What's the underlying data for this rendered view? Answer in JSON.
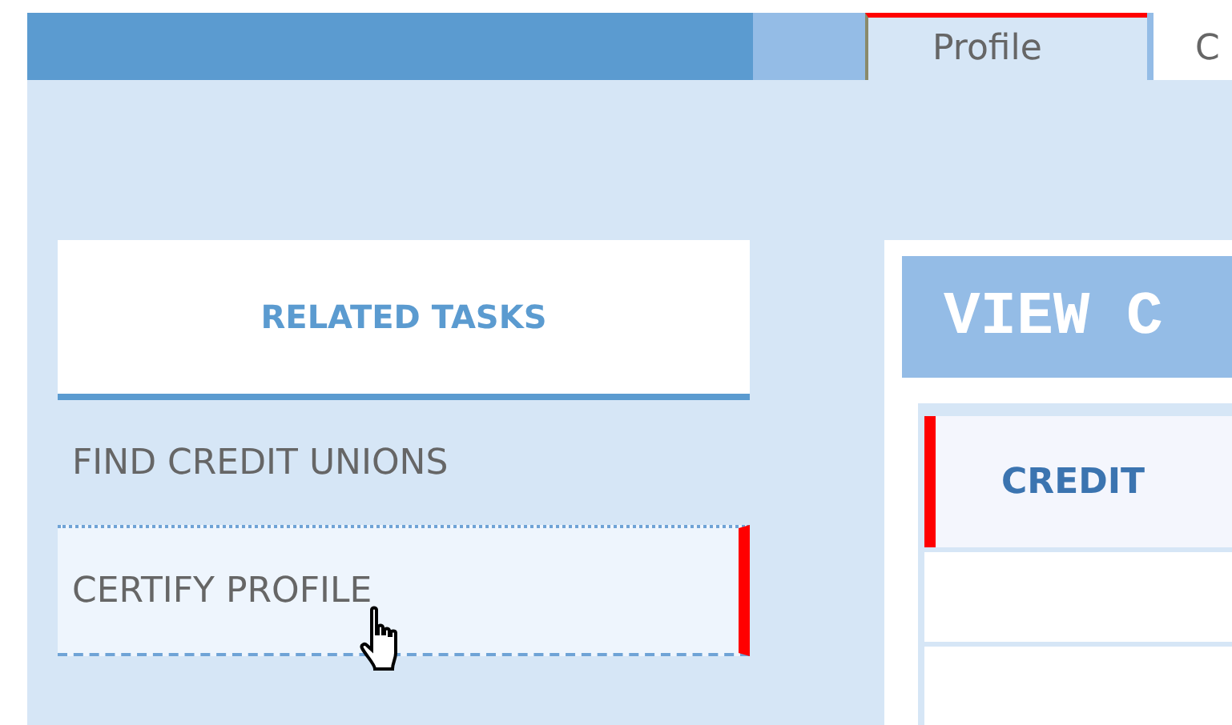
{
  "tabs": [
    {
      "label": "Profile",
      "selected": true
    },
    {
      "label": "C",
      "selected": false
    }
  ],
  "related_tasks": {
    "title": "RELATED TASKS",
    "items": [
      {
        "label": "FIND CREDIT UNIONS",
        "hovered": false
      },
      {
        "label": "CERTIFY PROFILE",
        "hovered": true
      }
    ]
  },
  "panel": {
    "title": "VIEW C",
    "table": {
      "columns": [
        "CREDIT"
      ]
    }
  }
}
